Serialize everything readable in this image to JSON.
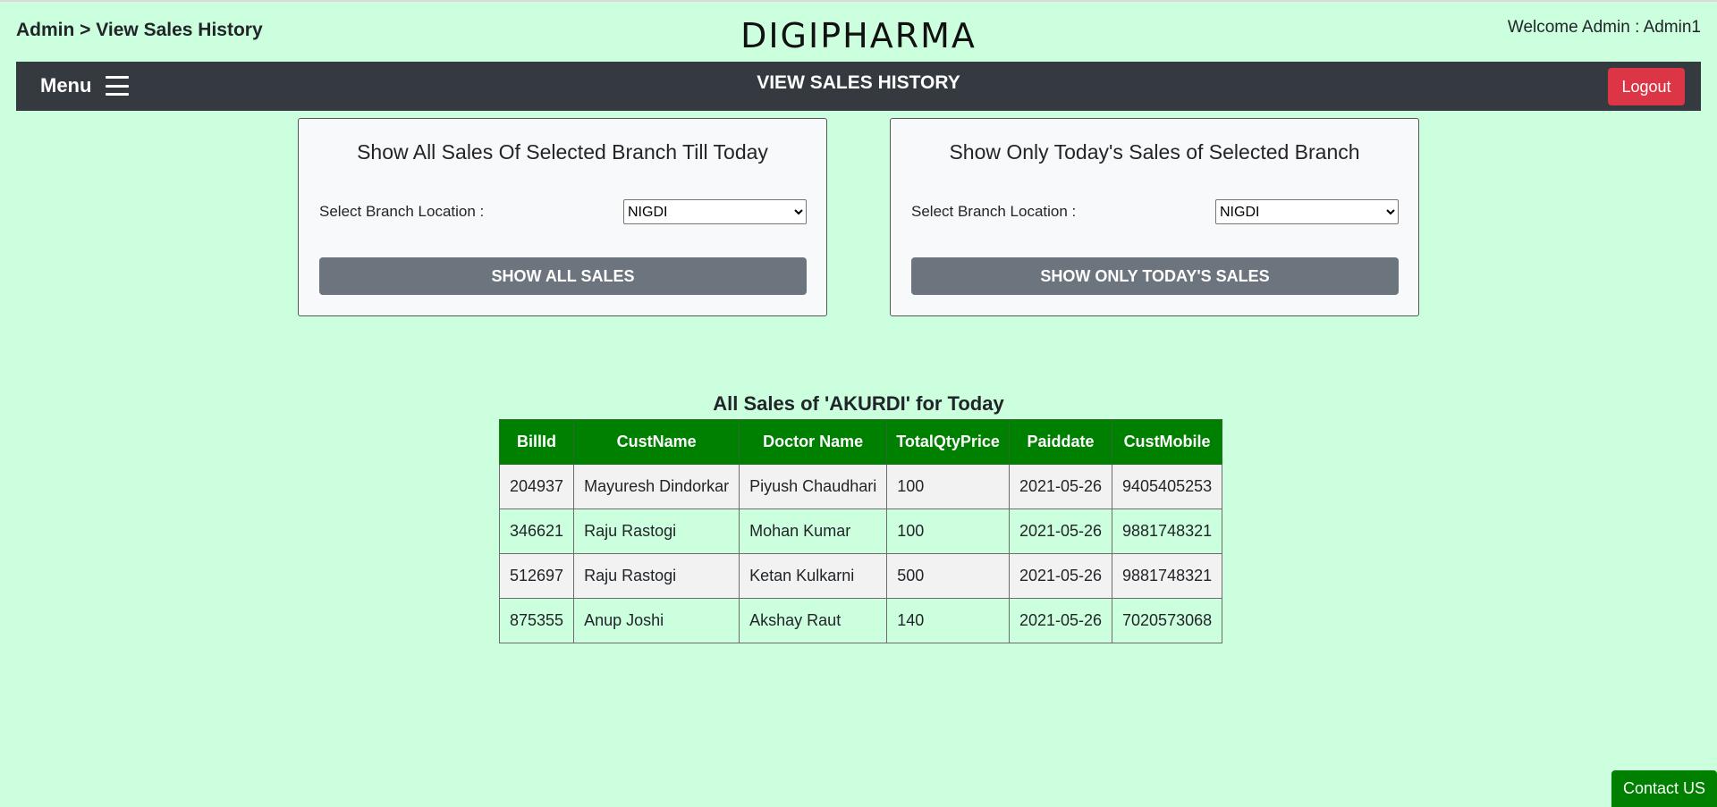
{
  "header": {
    "breadcrumb": "Admin > View Sales History",
    "brand": "DIGIPHARMA",
    "welcome": "Welcome Admin : Admin1"
  },
  "navbar": {
    "menu_label": "Menu",
    "title": "VIEW SALES HISTORY",
    "logout_label": "Logout"
  },
  "cards": {
    "all_sales": {
      "title": "Show All Sales Of Selected Branch Till Today",
      "select_label": "Select Branch Location :",
      "selected_branch": "NIGDI",
      "button_label": "SHOW ALL SALES"
    },
    "today_sales": {
      "title": "Show Only Today's Sales of Selected Branch",
      "select_label": "Select Branch Location :",
      "selected_branch": "NIGDI",
      "button_label": "SHOW ONLY TODAY'S SALES"
    }
  },
  "results": {
    "title": "All Sales of 'AKURDI' for Today",
    "columns": [
      "BillId",
      "CustName",
      "Doctor Name",
      "TotalQtyPrice",
      "Paiddate",
      "CustMobile"
    ],
    "rows": [
      [
        "204937",
        "Mayuresh Dindorkar",
        "Piyush Chaudhari",
        "100",
        "2021-05-26",
        "9405405253"
      ],
      [
        "346621",
        "Raju Rastogi",
        "Mohan Kumar",
        "100",
        "2021-05-26",
        "9881748321"
      ],
      [
        "512697",
        "Raju Rastogi",
        "Ketan Kulkarni",
        "500",
        "2021-05-26",
        "9881748321"
      ],
      [
        "875355",
        "Anup Joshi",
        "Akshay Raut",
        "140",
        "2021-05-26",
        "7020573068"
      ]
    ]
  },
  "footer": {
    "contact_label": "Contact US"
  },
  "colors": {
    "page_background": "#ccffdd",
    "navbar": "#343a40",
    "logout": "#dc3545",
    "table_header": "#008000",
    "card_button": "#6c757d",
    "contact_button": "#008000"
  },
  "icons": {
    "menu": "hamburger-icon"
  }
}
